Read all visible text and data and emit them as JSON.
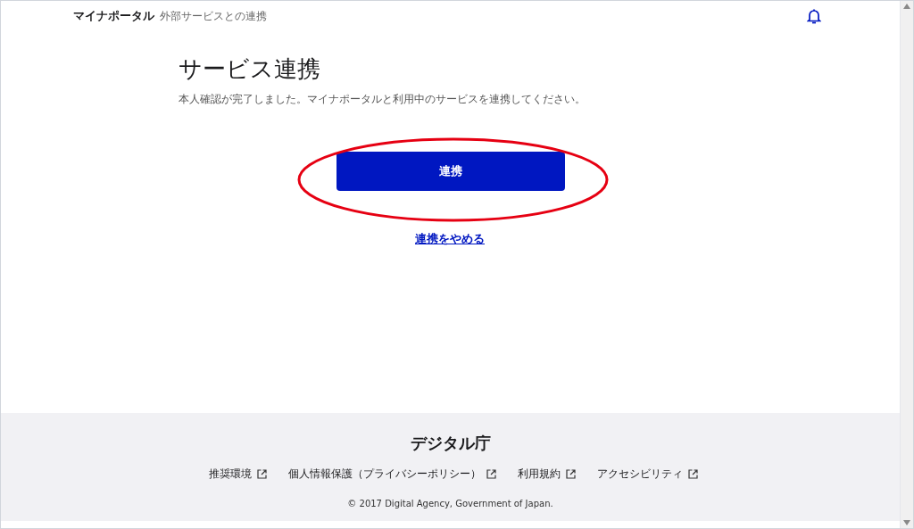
{
  "header": {
    "brand": "マイナポータル",
    "subtitle": "外部サービスとの連携"
  },
  "main": {
    "title": "サービス連携",
    "description": "本人確認が完了しました。マイナポータルと利用中のサービスを連携してください。",
    "primary_button": "連携",
    "cancel_link": "連携をやめる"
  },
  "annotation": {
    "kind": "ellipse",
    "color": "#e60012"
  },
  "footer": {
    "agency": "デジタル庁",
    "links": [
      {
        "label": "推奨環境"
      },
      {
        "label": "個人情報保護（プライバシーポリシー）"
      },
      {
        "label": "利用規約"
      },
      {
        "label": "アクセシビリティ"
      }
    ],
    "copyright": "© 2017 Digital Agency, Government of Japan."
  }
}
